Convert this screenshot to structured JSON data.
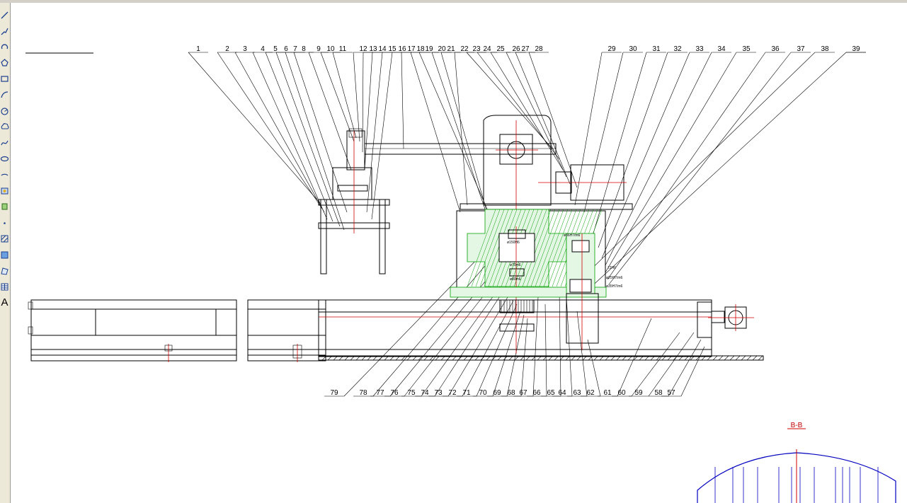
{
  "toolbar": {
    "tools": [
      {
        "name": "line-icon",
        "glyph": "line"
      },
      {
        "name": "polyline-icon",
        "glyph": "polyline"
      },
      {
        "name": "undo-arc-icon",
        "glyph": "arc"
      },
      {
        "name": "polygon-icon",
        "glyph": "polygon"
      },
      {
        "name": "rectangle-icon",
        "glyph": "rect"
      },
      {
        "name": "arc-icon",
        "glyph": "arc2"
      },
      {
        "name": "circle-icon",
        "glyph": "circle"
      },
      {
        "name": "revcloud-icon",
        "glyph": "cloud"
      },
      {
        "name": "spline-icon",
        "glyph": "spline"
      },
      {
        "name": "ellipse-icon",
        "glyph": "ellipse"
      },
      {
        "name": "ellipse-arc-icon",
        "glyph": "ellarc"
      },
      {
        "name": "insert-block-icon",
        "glyph": "block"
      },
      {
        "name": "make-block-icon",
        "glyph": "mkblock"
      },
      {
        "name": "point-icon",
        "glyph": "point"
      },
      {
        "name": "hatch-icon",
        "glyph": "hatch"
      },
      {
        "name": "gradient-icon",
        "glyph": "gradient"
      },
      {
        "name": "region-icon",
        "glyph": "region"
      },
      {
        "name": "table-icon",
        "glyph": "table"
      },
      {
        "name": "multiline-text-icon",
        "glyph": "text",
        "label": "A"
      }
    ]
  },
  "drawing": {
    "top_balloons": [
      "1",
      "2",
      "3",
      "4",
      "5",
      "6",
      "7",
      "8",
      "9",
      "10",
      "11",
      "12",
      "13",
      "14",
      "15",
      "16",
      "17",
      "18",
      "19",
      "20",
      "21",
      "22",
      "23",
      "24",
      "25",
      "26",
      "27",
      "28",
      "29",
      "30",
      "31",
      "32",
      "33",
      "34",
      "35",
      "36",
      "37",
      "38",
      "39"
    ],
    "bottom_balloons": [
      "79",
      "78",
      "77",
      "76",
      "75",
      "74",
      "73",
      "72",
      "71",
      "70",
      "69",
      "68",
      "67",
      "66",
      "65",
      "64",
      "63",
      "62",
      "61",
      "60",
      "59",
      "58",
      "57"
    ],
    "dimensions": [
      "ø36H7/m6",
      "ø150H6",
      "ø70m6",
      "ø80m6",
      "ø25H7/m6",
      "ø35H7/m6",
      "72H6"
    ],
    "section_label": "B-B",
    "colors": {
      "outline": "#000000",
      "centerline": "#d00000",
      "hatch": "#00a000",
      "view": "#0000c0"
    }
  }
}
